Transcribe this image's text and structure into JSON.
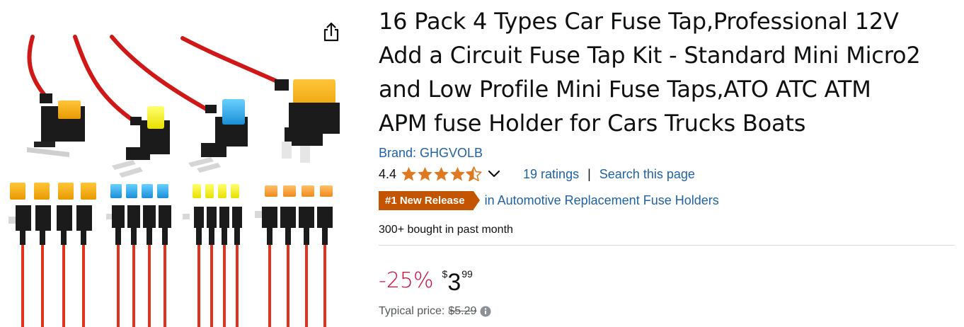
{
  "product": {
    "title": "16 Pack 4 Types Car Fuse Tap,Professional 12V Add a Circuit Fuse Tap Kit - Standard Mini Micro2 and Low Profile Mini Fuse Taps,ATO ATC ATM APM fuse Holder for Cars Trucks Boats",
    "title_lines": [
      "16 Pack 4 Types Car Fuse Tap,Professional 12V",
      "Add a Circuit Fuse Tap Kit - Standard Mini Micro2",
      "and Low Profile Mini Fuse Taps,ATO ATC ATM",
      "APM fuse Holder for Cars Trucks Boats"
    ],
    "brand": "Brand: GHGVOLB",
    "rating": {
      "value": "4.4",
      "stars": 4.4,
      "count_label": "19 ratings",
      "separator": "|",
      "search_link": "Search this page"
    },
    "badge": {
      "label": "#1 New Release",
      "category": "in Automotive Replacement Fuse Holders"
    },
    "bought": "300+ bought in past month",
    "price": {
      "discount": "-25%",
      "symbol": "$",
      "whole": "3",
      "fraction": "99",
      "typical_label": "Typical price:",
      "typical_value": "$5.29"
    }
  },
  "icons": {
    "share": "share-icon",
    "star": "star-icon",
    "chevron": "chevron-down-icon",
    "info": "info-icon"
  },
  "colors": {
    "link": "#2162a1",
    "star": "#de7921",
    "badge": "#c45500",
    "discount": "#cc0c39",
    "muted": "#565959"
  }
}
